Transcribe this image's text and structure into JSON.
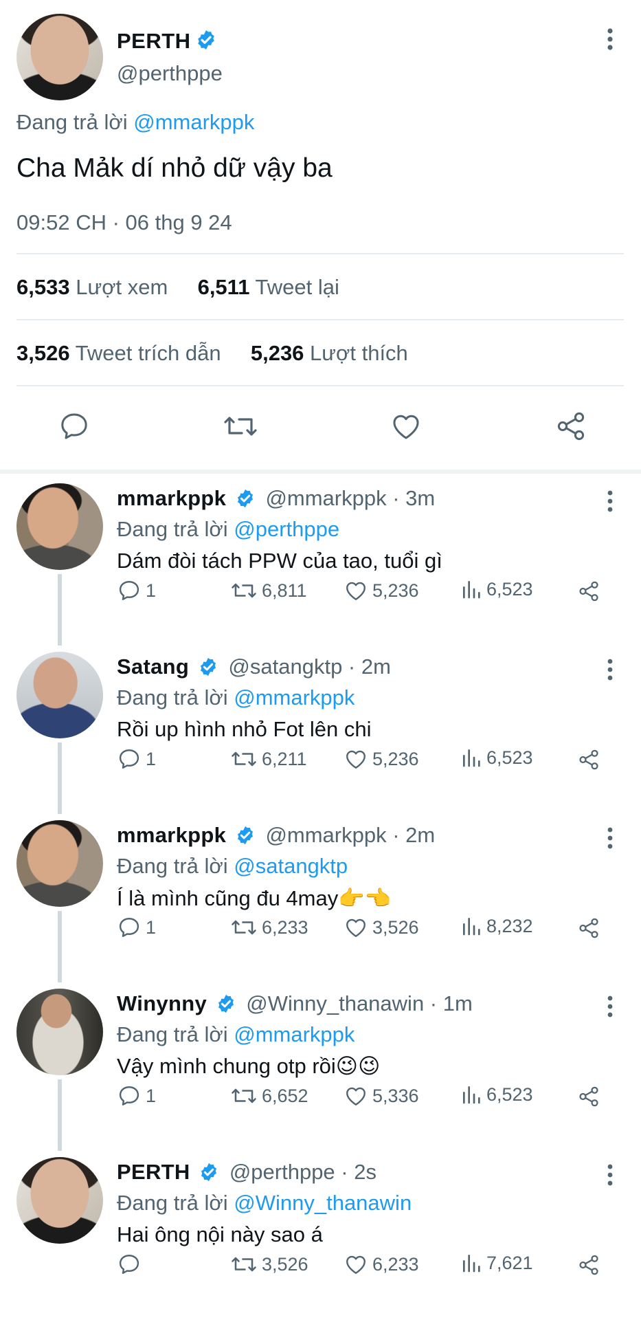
{
  "main_tweet": {
    "name": "PERTH",
    "handle": "@perthppe",
    "replying_prefix": "Đang trả lời",
    "replying_to": "@mmarkppk",
    "text": "Cha Mảk dí nhỏ dữ vậy ba",
    "timestamp": "09:52 CH · 06 thg 9 24",
    "stats": {
      "views_count": "6,533",
      "views_label": "Lượt xem",
      "retweets_count": "6,511",
      "retweets_label": "Tweet lại",
      "quotes_count": "3,526",
      "quotes_label": "Tweet trích dẫn",
      "likes_count": "5,236",
      "likes_label": "Lượt thích"
    }
  },
  "replies": [
    {
      "name": "mmarkppk",
      "meta": "@mmarkppk · 3m",
      "replying_prefix": "Đang trả lời",
      "replying_to": "@perthppe",
      "text": "Dám đòi tách PPW của tao, tuổi gì",
      "emoji": "",
      "reply_count": "1",
      "retweet_count": "6,811",
      "like_count": "5,236",
      "view_count": "6,523"
    },
    {
      "name": "Satang",
      "meta": "@satangktp · 2m",
      "replying_prefix": "Đang trả lời",
      "replying_to": "@mmarkppk",
      "text": "Rồi up hình nhỏ Fot lên chi",
      "emoji": "",
      "reply_count": "1",
      "retweet_count": "6,211",
      "like_count": "5,236",
      "view_count": "6,523"
    },
    {
      "name": "mmarkppk",
      "meta": "@mmarkppk · 2m",
      "replying_prefix": "Đang trả lời",
      "replying_to": "@satangktp",
      "text": "Í là mình cũng đu 4may",
      "emoji": "👉👈",
      "reply_count": "1",
      "retweet_count": "6,233",
      "like_count": "3,526",
      "view_count": "8,232"
    },
    {
      "name": "Winynny",
      "meta": "@Winny_thanawin · 1m",
      "replying_prefix": "Đang trả lời",
      "replying_to": "@mmarkppk",
      "text": "Vậy mình chung otp rồi",
      "emoji": "😉😉",
      "reply_count": "1",
      "retweet_count": "6,652",
      "like_count": "5,336",
      "view_count": "6,523"
    },
    {
      "name": "PERTH",
      "meta": "@perthppe · 2s",
      "replying_prefix": "Đang trả lời",
      "replying_to": "@Winny_thanawin",
      "text": "Hai ông nội này sao á",
      "emoji": "",
      "reply_count": "",
      "retweet_count": "3,526",
      "like_count": "6,233",
      "view_count": "7,621"
    }
  ],
  "colors": {
    "accent": "#1d9bf0",
    "muted": "#536471",
    "verified": "#1d9bf0"
  },
  "icons": [
    "verified-badge-icon",
    "more-vertical-icon",
    "reply-icon",
    "retweet-icon",
    "like-icon",
    "views-icon",
    "share-icon"
  ]
}
